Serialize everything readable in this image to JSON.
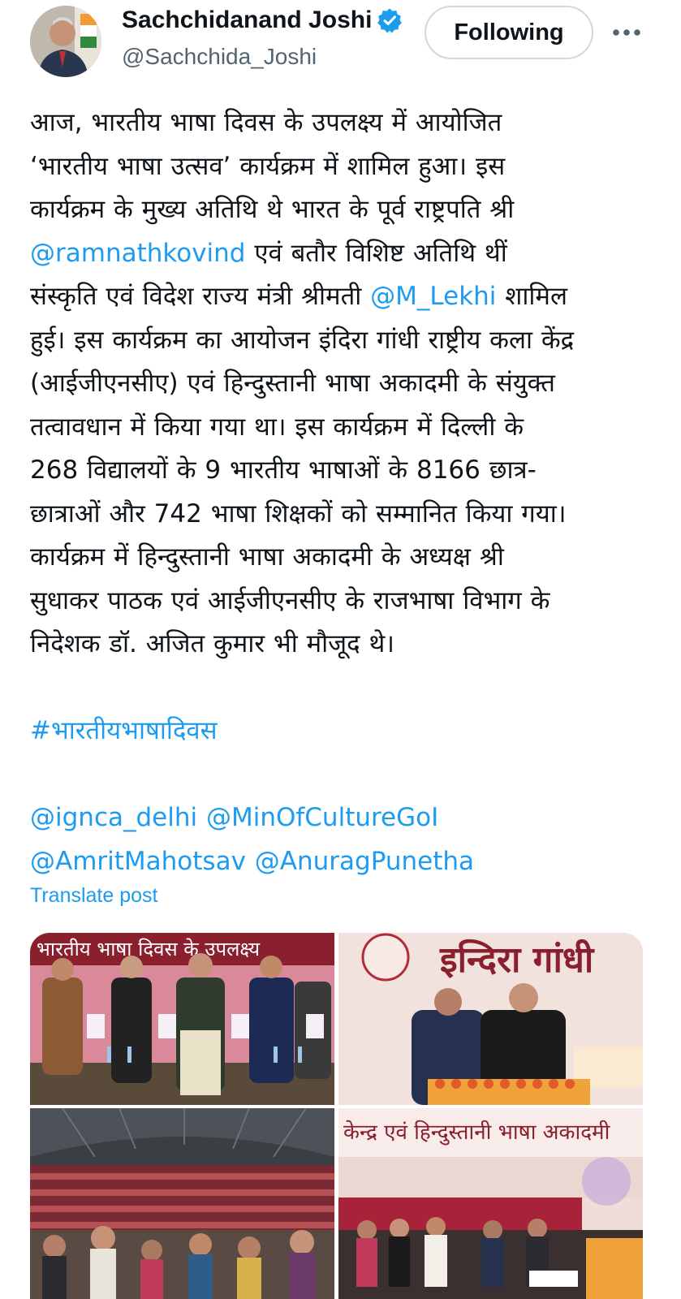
{
  "user": {
    "display_name": "Sachchidanand Joshi",
    "handle": "@Sachchida_Joshi",
    "verified": true,
    "follow_button_label": "Following"
  },
  "tweet": {
    "lines": [
      [
        {
          "t": "आज, भारतीय भाषा दिवस के उपलक्ष्य में आयोजित"
        }
      ],
      [
        {
          "t": "‘भारतीय भाषा उत्सव’ कार्यक्रम में शामिल हुआ। इस"
        }
      ],
      [
        {
          "t": "कार्यक्रम के मुख्य अतिथि थे भारत के पूर्व राष्ट्रपति श्री"
        }
      ],
      [
        {
          "t": "@ramnathkovind",
          "link": true
        },
        {
          "t": "  एवं बतौर विशिष्ट अतिथि थीं"
        }
      ],
      [
        {
          "t": "संस्कृति एवं विदेश राज्य मंत्री श्रीमती "
        },
        {
          "t": "@M_Lekhi",
          "link": true
        },
        {
          "t": " शामिल"
        }
      ],
      [
        {
          "t": "हुई। इस कार्यक्रम का आयोजन इंदिरा गांधी राष्ट्रीय कला केंद्र"
        }
      ],
      [
        {
          "t": "(आईजीएनसीए) एवं हिन्दुस्तानी भाषा अकादमी के संयुक्त"
        }
      ],
      [
        {
          "t": "तत्वावधान में किया गया था। इस कार्यक्रम में दिल्ली के"
        }
      ],
      [
        {
          "t": "268 विद्यालयों के 9 भारतीय भाषाओं के 8166 छात्र-"
        }
      ],
      [
        {
          "t": "छात्राओं और 742 भाषा शिक्षकों को सम्मानित किया गया।"
        }
      ],
      [
        {
          "t": "कार्यक्रम में हिन्दुस्तानी भाषा अकादमी के अध्यक्ष श्री"
        }
      ],
      [
        {
          "t": "सुधाकर पाठक एवं आईजीएनसीए के राजभाषा विभाग के"
        }
      ],
      [
        {
          "t": "निदेशक डॉ. अजित कुमार भी मौजूद थे।"
        }
      ],
      [],
      [
        {
          "t": "#भारतीयभाषादिवस",
          "link": true
        }
      ],
      [],
      [
        {
          "t": "@ignca_delhi",
          "link": true
        },
        {
          "t": " "
        },
        {
          "t": "@MinOfCultureGoI",
          "link": true
        }
      ],
      [
        {
          "t": "@AmritMahotsav",
          "link": true
        },
        {
          "t": " "
        },
        {
          "t": "@AnuragPunetha",
          "link": true
        }
      ]
    ],
    "translate_label": "Translate post"
  },
  "media": {
    "photos": [
      {
        "name": "book-release-photo",
        "caption_text": "भारतीय भाषा दिवस के उपलक्ष्य"
      },
      {
        "name": "speech-podium-photo",
        "caption_text": "इन्दिरा गांधी"
      },
      {
        "name": "audience-photo"
      },
      {
        "name": "felicitation-photo",
        "caption_text": "केन्द्र एवं हिन्दुस्तानी भाषा अकादमी"
      }
    ]
  },
  "colors": {
    "link": "#1d9bf0",
    "text": "#0f1419",
    "secondary": "#536471",
    "border": "#cfd9de"
  }
}
